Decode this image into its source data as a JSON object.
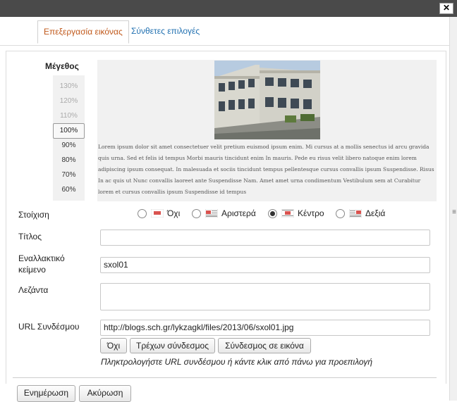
{
  "window": {
    "close_label": "✕"
  },
  "tabs": [
    {
      "label": "Επεξεργασία εικόνας"
    },
    {
      "label": "Σύνθετες επιλογές"
    }
  ],
  "size": {
    "label": "Μέγεθος",
    "options": [
      "130%",
      "120%",
      "110%",
      "100%",
      "90%",
      "80%",
      "70%",
      "60%"
    ],
    "selected": "100%"
  },
  "preview": {
    "text": "Lorem ipsum dolor sit amet consectetuer velit pretium euismod ipsum enim. Mi cursus at a mollis senectus id arcu gravida quis urna. Sed et felis id tempus Morbi mauris tincidunt enim In mauris. Pede eu risus velit libero natoque enim lorem adipiscing ipsum consequat. In malesuada et sociis tincidunt tempus pellentesque cursus convallis ipsum Suspendisse. Risus In ac quis ut Nunc convallis laoreet ante Suspendisse Nam. Amet amet urna condimentum Vestibulum sem at Curabitur lorem et cursus convallis ipsum Suspendisse id tempus"
  },
  "alignment": {
    "label": "Στοίχιση",
    "options": [
      {
        "label": "Όχι",
        "checked": false
      },
      {
        "label": "Αριστερά",
        "checked": false
      },
      {
        "label": "Κέντρο",
        "checked": true
      },
      {
        "label": "Δεξιά",
        "checked": false
      }
    ],
    "accent": "#d9534f"
  },
  "fields": {
    "title_label": "Τίτλος",
    "title_value": "",
    "alt_label_line1": "Εναλλακτικό",
    "alt_label_line2": "κείμενο",
    "alt_value": "sxol01",
    "caption_label": "Λεζάντα",
    "caption_value": "",
    "url_label": "URL Συνδέσμου",
    "url_value": "http://blogs.sch.gr/lykzagkl/files/2013/06/sxol01.jpg"
  },
  "link_buttons": {
    "none": "Όχι",
    "current": "Τρέχων σύνδεσμος",
    "to_image": "Σύνδεσμος σε εικόνα"
  },
  "hint": "Πληκτρολογήστε URL συνδέσμου ή κάντε κλικ από πάνω για προεπιλογή",
  "footer": {
    "update": "Ενημέρωση",
    "cancel": "Ακύρωση"
  }
}
